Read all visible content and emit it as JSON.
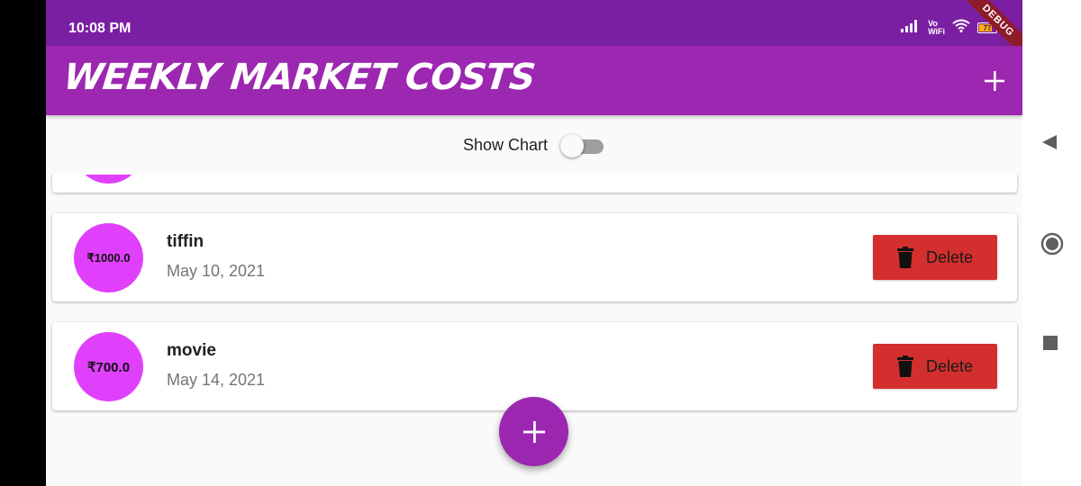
{
  "status_bar": {
    "time": "10:08 PM",
    "volte_line1": "Vo",
    "volte_line2": "WiFi",
    "battery_level": "77",
    "debug_label": "DEBUG"
  },
  "app_bar": {
    "title": "Weekly Market Costs",
    "add_icon": "plus-icon"
  },
  "chart_toggle": {
    "label": "Show Chart",
    "enabled": false
  },
  "transactions": [
    {
      "amount": "",
      "title": "",
      "date": "",
      "delete_label": ""
    },
    {
      "amount": "₹1000.0",
      "title": "tiffin",
      "date": "May 10, 2021",
      "delete_label": "Delete"
    },
    {
      "amount": "₹700.0",
      "title": "movie",
      "date": "May 14, 2021",
      "delete_label": "Delete"
    }
  ],
  "fab": {
    "icon": "plus-icon"
  },
  "colors": {
    "primary": "#9c27b0",
    "primary_dark": "#7b1fa2",
    "accent": "#e040fb",
    "delete": "#d32f2f"
  },
  "nav_icons": [
    "back-icon",
    "home-icon",
    "recents-icon"
  ]
}
